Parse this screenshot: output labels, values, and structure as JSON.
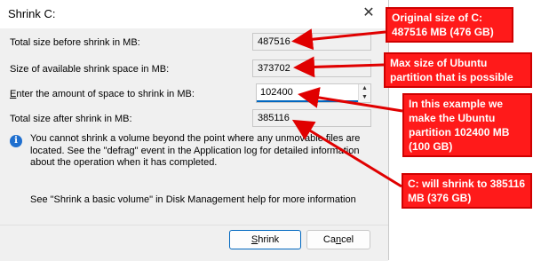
{
  "dialog": {
    "title": "Shrink C:",
    "close_glyph": "✕",
    "fields": [
      {
        "label_pre": "Total size before shrink in MB:",
        "label_u": "",
        "label_post": "",
        "value": "487516"
      },
      {
        "label_pre": "Size of available shrink space in MB:",
        "label_u": "",
        "label_post": "",
        "value": "373702"
      },
      {
        "label_pre": "",
        "label_u": "E",
        "label_post": "nter the amount of space to shrink in MB:",
        "value": "102400"
      },
      {
        "label_pre": "Total size after shrink in MB:",
        "label_u": "",
        "label_post": "",
        "value": "385116"
      }
    ],
    "info_icon": "i",
    "info_text": "You cannot shrink a volume beyond the point where any unmovable files are located. See the \"defrag\" event in the Application log for detailed information about the operation when it has completed.",
    "help_text": "See \"Shrink a basic volume\" in Disk Management help for more information",
    "buttons": {
      "shrink_u": "S",
      "shrink_rest": "hrink",
      "cancel_pre": "Ca",
      "cancel_u": "n",
      "cancel_post": "cel"
    },
    "spin_up": "▲",
    "spin_down": "▼"
  },
  "annotations": [
    {
      "line1": "Original size of C:",
      "line2": "487516 MB (476 GB)"
    },
    {
      "line1": "Max size of Ubuntu",
      "line2": "partition that is possible"
    },
    {
      "line1": "In this example we",
      "line2": "make the Ubuntu",
      "line3": "partition 102400 MB",
      "line4": "(100 GB)"
    },
    {
      "line1": "C: will shrink to 385116",
      "line2": "MB (376 GB)"
    }
  ],
  "colors": {
    "annotation_bg": "#ff1a1a",
    "arrow": "#e00000",
    "accent": "#0067c0",
    "info_icon": "#1f6fcf"
  }
}
